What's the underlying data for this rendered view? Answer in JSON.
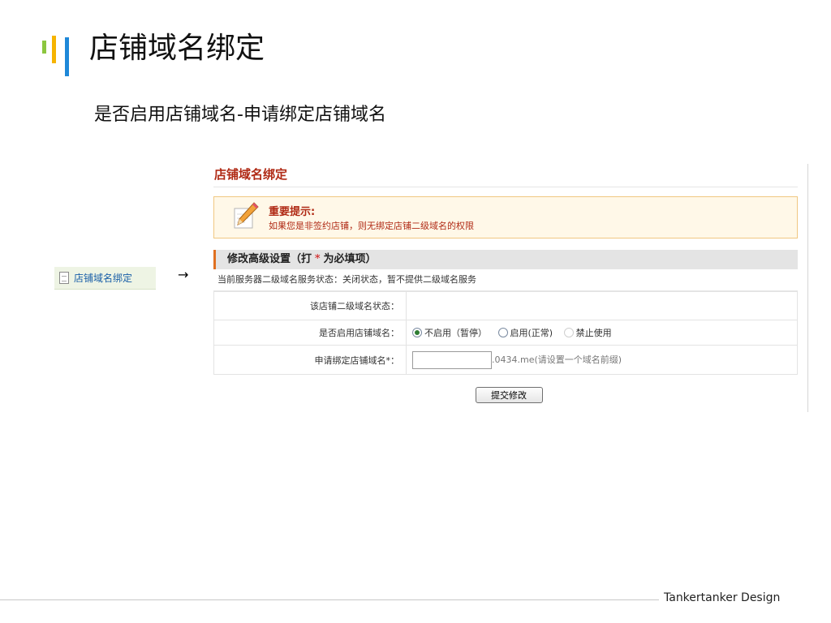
{
  "slide": {
    "title": "店铺域名绑定",
    "subtitle": "是否启用店铺域名-申请绑定店铺域名",
    "footer": "Tankertanker Design"
  },
  "nav": {
    "item_label": "店铺域名绑定",
    "item_icon": "document-icon",
    "arrow": "→"
  },
  "panel": {
    "title": "店铺域名绑定",
    "notice": {
      "icon": "pencil-icon",
      "title": "重要提示:",
      "text": "如果您是非签约店铺，则无绑定店铺二级域名的权限"
    },
    "section": {
      "title_prefix": "修改高级设置（打",
      "required_mark": "*",
      "title_suffix": "为必填项）"
    },
    "server_status": "当前服务器二级域名服务状态：关闭状态，暂不提供二级域名服务",
    "rows": {
      "status_label": "该店铺二级域名状态：",
      "status_value": "",
      "enable_label": "是否启用店铺域名：",
      "enable_options": [
        "不启用（暂停）",
        "启用(正常)",
        "禁止使用"
      ],
      "enable_selected": 0,
      "apply_label": "申请绑定店铺域名*：",
      "apply_value": "",
      "apply_suffix": ".0434.me(请设置一个域名前缀)"
    },
    "submit_label": "提交修改"
  },
  "colors": {
    "accent_red": "#b02a15",
    "notice_bg": "#fff8e8",
    "logo_green": "#8cc63f",
    "logo_yellow": "#f6b400",
    "logo_blue": "#1e88d8"
  }
}
